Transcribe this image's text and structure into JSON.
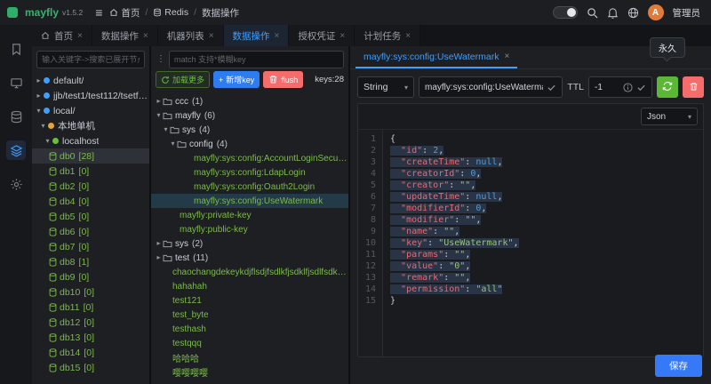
{
  "header": {
    "logo_text": "mayfly",
    "version": "v1.5.2",
    "breadcrumb": [
      {
        "label": "首页",
        "icon": "home"
      },
      {
        "label": "Redis",
        "icon": "dbmini"
      },
      {
        "label": "数据操作"
      }
    ],
    "right_icons": [
      {
        "name": "search-icon",
        "icon": "search"
      },
      {
        "name": "notification-icon",
        "icon": "bell"
      },
      {
        "name": "language-icon",
        "icon": "globe"
      }
    ],
    "avatar_letter": "A",
    "username": "管理员"
  },
  "rail": {
    "items": [
      {
        "name": "bookmark-icon",
        "icon": "bookmark",
        "active": false
      },
      {
        "name": "monitor-icon",
        "icon": "monitor",
        "active": false
      },
      {
        "name": "database-icon",
        "icon": "database",
        "active": false
      },
      {
        "name": "layers-icon",
        "icon": "layers",
        "active": true
      },
      {
        "name": "settings-icon",
        "icon": "gear",
        "active": false
      }
    ]
  },
  "tab_bar": [
    {
      "label": "首页",
      "icon": "home",
      "active": false
    },
    {
      "label": "数据操作",
      "active": false
    },
    {
      "label": "机器列表",
      "active": false
    },
    {
      "label": "数据操作",
      "active": true
    },
    {
      "label": "授权凭证",
      "active": false
    },
    {
      "label": "计划任务",
      "active": false
    }
  ],
  "left_panel": {
    "search_placeholder": "输入关键字->搜索已展开节点信息",
    "tree": [
      {
        "label": "default/",
        "level": 0,
        "icon": "conn",
        "expand": "closed"
      },
      {
        "label": "jjb/test1/test112/tsetfasfasdfa",
        "level": 0,
        "icon": "conn",
        "expand": "closed"
      },
      {
        "label": "local/",
        "level": 0,
        "icon": "conn",
        "expand": "open"
      },
      {
        "label": "本地单机",
        "level": 1,
        "icon": "group",
        "expand": "open"
      },
      {
        "label": "localhost",
        "level": 2,
        "icon": "host",
        "expand": "open"
      },
      {
        "label": "db0",
        "count": "[28]",
        "level": 3,
        "icon": "db",
        "green": true,
        "selected": true
      },
      {
        "label": "db1",
        "count": "[0]",
        "level": 3,
        "icon": "db",
        "green": true
      },
      {
        "label": "db2",
        "count": "[0]",
        "level": 3,
        "icon": "db",
        "green": true
      },
      {
        "label": "db4",
        "count": "[0]",
        "level": 3,
        "icon": "db",
        "green": true
      },
      {
        "label": "db5",
        "count": "[0]",
        "level": 3,
        "icon": "db",
        "green": true
      },
      {
        "label": "db6",
        "count": "[0]",
        "level": 3,
        "icon": "db",
        "green": true
      },
      {
        "label": "db7",
        "count": "[0]",
        "level": 3,
        "icon": "db",
        "green": true
      },
      {
        "label": "db8",
        "count": "[1]",
        "level": 3,
        "icon": "db",
        "green": true
      },
      {
        "label": "db9",
        "count": "[0]",
        "level": 3,
        "icon": "db",
        "green": true
      },
      {
        "label": "db10",
        "count": "[0]",
        "level": 3,
        "icon": "db",
        "green": true
      },
      {
        "label": "db11",
        "count": "[0]",
        "level": 3,
        "icon": "db",
        "green": true
      },
      {
        "label": "db12",
        "count": "[0]",
        "level": 3,
        "icon": "db",
        "green": true
      },
      {
        "label": "db13",
        "count": "[0]",
        "level": 3,
        "icon": "db",
        "green": true
      },
      {
        "label": "db14",
        "count": "[0]",
        "level": 3,
        "icon": "db",
        "green": true
      },
      {
        "label": "db15",
        "count": "[0]",
        "level": 3,
        "icon": "db",
        "green": true
      }
    ]
  },
  "key_panel": {
    "search_placeholder": "match 支持*模糊key",
    "load_more_label": "加载更多",
    "new_key_label": "新增key",
    "flush_label": "flush",
    "keys_count": "keys:28",
    "tree": [
      {
        "type": "folder",
        "label": "ccc",
        "count": "(1)",
        "level": 0,
        "expanded": false
      },
      {
        "type": "folder",
        "label": "mayfly",
        "count": "(6)",
        "level": 0,
        "expanded": true
      },
      {
        "type": "folder",
        "label": "sys",
        "count": "(4)",
        "level": 1,
        "expanded": true
      },
      {
        "type": "folder",
        "label": "config",
        "count": "(4)",
        "level": 2,
        "expanded": true
      },
      {
        "type": "key",
        "label": "mayfly:sys:config:AccountLoginSecurity",
        "level": 3
      },
      {
        "type": "key",
        "label": "mayfly:sys:config:LdapLogin",
        "level": 3
      },
      {
        "type": "key",
        "label": "mayfly:sys:config:Oauth2Login",
        "level": 3
      },
      {
        "type": "key",
        "label": "mayfly:sys:config:UseWatermark",
        "level": 3,
        "selected": true
      },
      {
        "type": "key",
        "label": "mayfly:private-key",
        "level": 1
      },
      {
        "type": "key",
        "label": "mayfly:public-key",
        "level": 1
      },
      {
        "type": "folder",
        "label": "sys",
        "count": "(2)",
        "level": 0,
        "expanded": false
      },
      {
        "type": "folder",
        "label": "test",
        "count": "(11)",
        "level": 0,
        "expanded": false
      },
      {
        "type": "key",
        "label": "chaochangdekeykdjflsdjfsdlkfjsdklfjsdlfsdkfjslkfjdlkjfljalfjs",
        "level": 0
      },
      {
        "type": "key",
        "label": "hahahah",
        "level": 0
      },
      {
        "type": "key",
        "label": "test121",
        "level": 0
      },
      {
        "type": "key",
        "label": "test_byte",
        "level": 0
      },
      {
        "type": "key",
        "label": "testhash",
        "level": 0
      },
      {
        "type": "key",
        "label": "testqqq",
        "level": 0
      },
      {
        "type": "key",
        "label": "哈哈哈",
        "level": 0
      },
      {
        "type": "key",
        "label": "嘤嘤嘤嘤",
        "level": 0
      }
    ]
  },
  "detail_panel": {
    "tab_label": "mayfly:sys:config:UseWatermark",
    "tooltip_text": "永久",
    "type_value": "String",
    "key_value": "mayfly:sys:config:UseWatermark",
    "ttl_label": "TTL",
    "ttl_value": "-1",
    "format_value": "Json",
    "save_label": "保存",
    "editor_lines": [
      {
        "n": 1,
        "sel": false,
        "t": [
          [
            "p",
            "{"
          ]
        ]
      },
      {
        "n": 2,
        "sel": true,
        "t": [
          [
            "p",
            "  "
          ],
          [
            "k",
            "\"id\""
          ],
          [
            "p",
            ": "
          ],
          [
            "n",
            "2"
          ],
          [
            "p",
            ","
          ]
        ]
      },
      {
        "n": 3,
        "sel": true,
        "t": [
          [
            "p",
            "  "
          ],
          [
            "k",
            "\"createTime\""
          ],
          [
            "p",
            ": "
          ],
          [
            "u",
            "null"
          ],
          [
            "p",
            ","
          ]
        ]
      },
      {
        "n": 4,
        "sel": true,
        "t": [
          [
            "p",
            "  "
          ],
          [
            "k",
            "\"creatorId\""
          ],
          [
            "p",
            ": "
          ],
          [
            "n",
            "0"
          ],
          [
            "p",
            ","
          ]
        ]
      },
      {
        "n": 5,
        "sel": true,
        "t": [
          [
            "p",
            "  "
          ],
          [
            "k",
            "\"creator\""
          ],
          [
            "p",
            ": "
          ],
          [
            "s",
            "\"\""
          ],
          [
            "p",
            ","
          ]
        ]
      },
      {
        "n": 6,
        "sel": true,
        "t": [
          [
            "p",
            "  "
          ],
          [
            "k",
            "\"updateTime\""
          ],
          [
            "p",
            ": "
          ],
          [
            "u",
            "null"
          ],
          [
            "p",
            ","
          ]
        ]
      },
      {
        "n": 7,
        "sel": true,
        "t": [
          [
            "p",
            "  "
          ],
          [
            "k",
            "\"modifierId\""
          ],
          [
            "p",
            ": "
          ],
          [
            "n",
            "0"
          ],
          [
            "p",
            ","
          ]
        ]
      },
      {
        "n": 8,
        "sel": true,
        "t": [
          [
            "p",
            "  "
          ],
          [
            "k",
            "\"modifier\""
          ],
          [
            "p",
            ": "
          ],
          [
            "s",
            "\"\""
          ],
          [
            "p",
            ","
          ]
        ]
      },
      {
        "n": 9,
        "sel": true,
        "t": [
          [
            "p",
            "  "
          ],
          [
            "k",
            "\"name\""
          ],
          [
            "p",
            ": "
          ],
          [
            "s",
            "\"\""
          ],
          [
            "p",
            ","
          ]
        ]
      },
      {
        "n": 10,
        "sel": true,
        "t": [
          [
            "p",
            "  "
          ],
          [
            "k",
            "\"key\""
          ],
          [
            "p",
            ": "
          ],
          [
            "s",
            "\"UseWatermark\""
          ],
          [
            "p",
            ","
          ]
        ]
      },
      {
        "n": 11,
        "sel": true,
        "t": [
          [
            "p",
            "  "
          ],
          [
            "k",
            "\"params\""
          ],
          [
            "p",
            ": "
          ],
          [
            "s",
            "\"\""
          ],
          [
            "p",
            ","
          ]
        ]
      },
      {
        "n": 12,
        "sel": true,
        "t": [
          [
            "p",
            "  "
          ],
          [
            "k",
            "\"value\""
          ],
          [
            "p",
            ": "
          ],
          [
            "s",
            "\"0\""
          ],
          [
            "p",
            ","
          ]
        ]
      },
      {
        "n": 13,
        "sel": true,
        "t": [
          [
            "p",
            "  "
          ],
          [
            "k",
            "\"remark\""
          ],
          [
            "p",
            ": "
          ],
          [
            "s",
            "\"\""
          ],
          [
            "p",
            ","
          ]
        ]
      },
      {
        "n": 14,
        "sel": true,
        "t": [
          [
            "p",
            "  "
          ],
          [
            "k",
            "\"permission\""
          ],
          [
            "p",
            ": "
          ],
          [
            "s",
            "\"all\""
          ]
        ]
      },
      {
        "n": 15,
        "sel": false,
        "t": [
          [
            "p",
            "}"
          ]
        ]
      }
    ]
  }
}
